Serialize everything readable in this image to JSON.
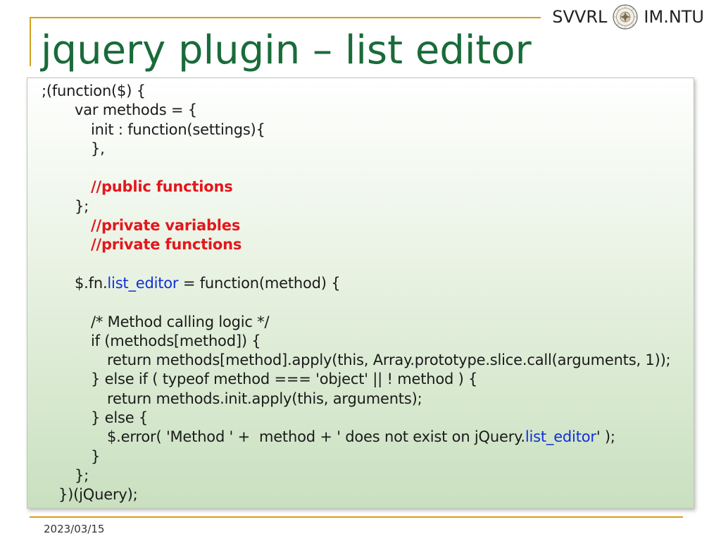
{
  "header": {
    "left_label": "SVVRL",
    "right_label": "IM.NTU"
  },
  "title": "jquery plugin – list editor",
  "code": {
    "l1": ";(function($) {",
    "l2": "var methods = {",
    "l3": "init : function(settings){",
    "l4": "},",
    "l6": "//public functions",
    "l7": "};",
    "l8": "//private variables",
    "l9": "//private functions",
    "l11_a": "$.fn.",
    "l11_b": "list_editor",
    "l11_c": " = function(method) {",
    "l13": "/* Method calling logic */",
    "l14": "if (methods[method]) {",
    "l15": "return methods[method].apply(this, Array.prototype.slice.call(arguments, 1));",
    "l16": "} else if ( typeof method === 'object' || ! method ) {",
    "l17": "return methods.init.apply(this, arguments);",
    "l18": "} else {",
    "l19_a": "$.error( 'Method ' +  method + ' does not exist on jQuery.",
    "l19_b": "list_editor",
    "l19_c": "' );",
    "l20": "}",
    "l21": "};",
    "l22": "})(jQuery);"
  },
  "footer": {
    "date": "2023/03/15"
  },
  "colors": {
    "title": "#1a6b3a",
    "accent_line": "#d4a017",
    "comment": "#e3171c",
    "highlight": "#1030d8"
  },
  "icons": {
    "seal": "university-seal-icon"
  }
}
